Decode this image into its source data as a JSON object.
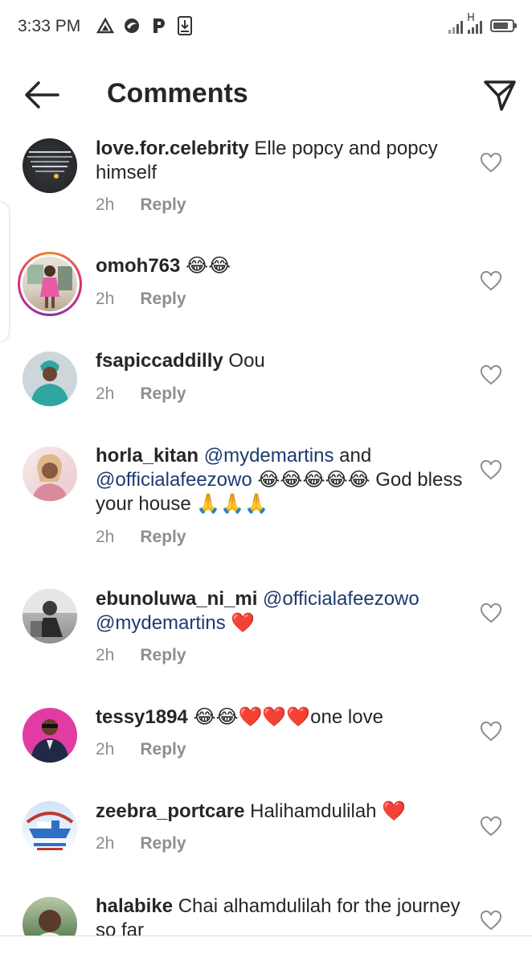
{
  "status_bar": {
    "time": "3:33 PM",
    "left_icons": [
      "delta-icon",
      "swirl-icon",
      "parking-p-icon",
      "download-icon"
    ],
    "right_icons": [
      "signal-icon",
      "signal-h-icon",
      "battery-icon"
    ]
  },
  "header": {
    "title": "Comments",
    "back_icon": "arrow-left-icon",
    "share_icon": "paper-plane-icon"
  },
  "comments": [
    {
      "username": "love.for.celebrity",
      "text": " Elle popcy and popcy himself",
      "time": "2h",
      "reply_label": "Reply",
      "avatar_colors": [
        "#2b2d31",
        "#3a3c41"
      ]
    },
    {
      "username": "omoh763",
      "text": " 😂😂",
      "time": "2h",
      "reply_label": "Reply",
      "has_story_ring": true,
      "avatar_colors": [
        "#e8e1d8",
        "#e85aa6"
      ]
    },
    {
      "username": "fsapiccaddilly",
      "text": " Oou",
      "time": "2h",
      "reply_label": "Reply",
      "avatar_colors": [
        "#cdd6da",
        "#2fa6a0"
      ]
    },
    {
      "username": "horla_kitan",
      "mention1": " @mydemartins",
      "text_a": "  and ",
      "mention2": "@officialafeezowo",
      "text_b": " 😂😂😂😂😂 God bless your house 🙏🙏🙏",
      "time": "2h",
      "reply_label": "Reply",
      "avatar_colors": [
        "#f0d9d2",
        "#d98b9c"
      ]
    },
    {
      "username": "ebunoluwa_ni_mi",
      "mention1": " @officialafeezowo",
      "mention2": "@mydemartins",
      "text_b": " ❤️",
      "time": "2h",
      "reply_label": "Reply",
      "avatar_colors": [
        "#9a9a9a",
        "#3b3b3b"
      ]
    },
    {
      "username": "tessy1894",
      "text": " 😂😂❤️❤️❤️one love",
      "time": "2h",
      "reply_label": "Reply",
      "avatar_colors": [
        "#e23ca4",
        "#1f2a44"
      ]
    },
    {
      "username": "zeebra_portcare",
      "text": " Halihamdulilah ❤️",
      "time": "2h",
      "reply_label": "Reply",
      "avatar_colors": [
        "#2f6fc4",
        "#cfe3f6"
      ]
    },
    {
      "username": "halabike",
      "text": " Chai alhamdulilah for the journey so far",
      "avatar_colors": [
        "#3f6b3a",
        "#b9c9a8"
      ]
    }
  ],
  "like_icon": "heart-outline-icon"
}
